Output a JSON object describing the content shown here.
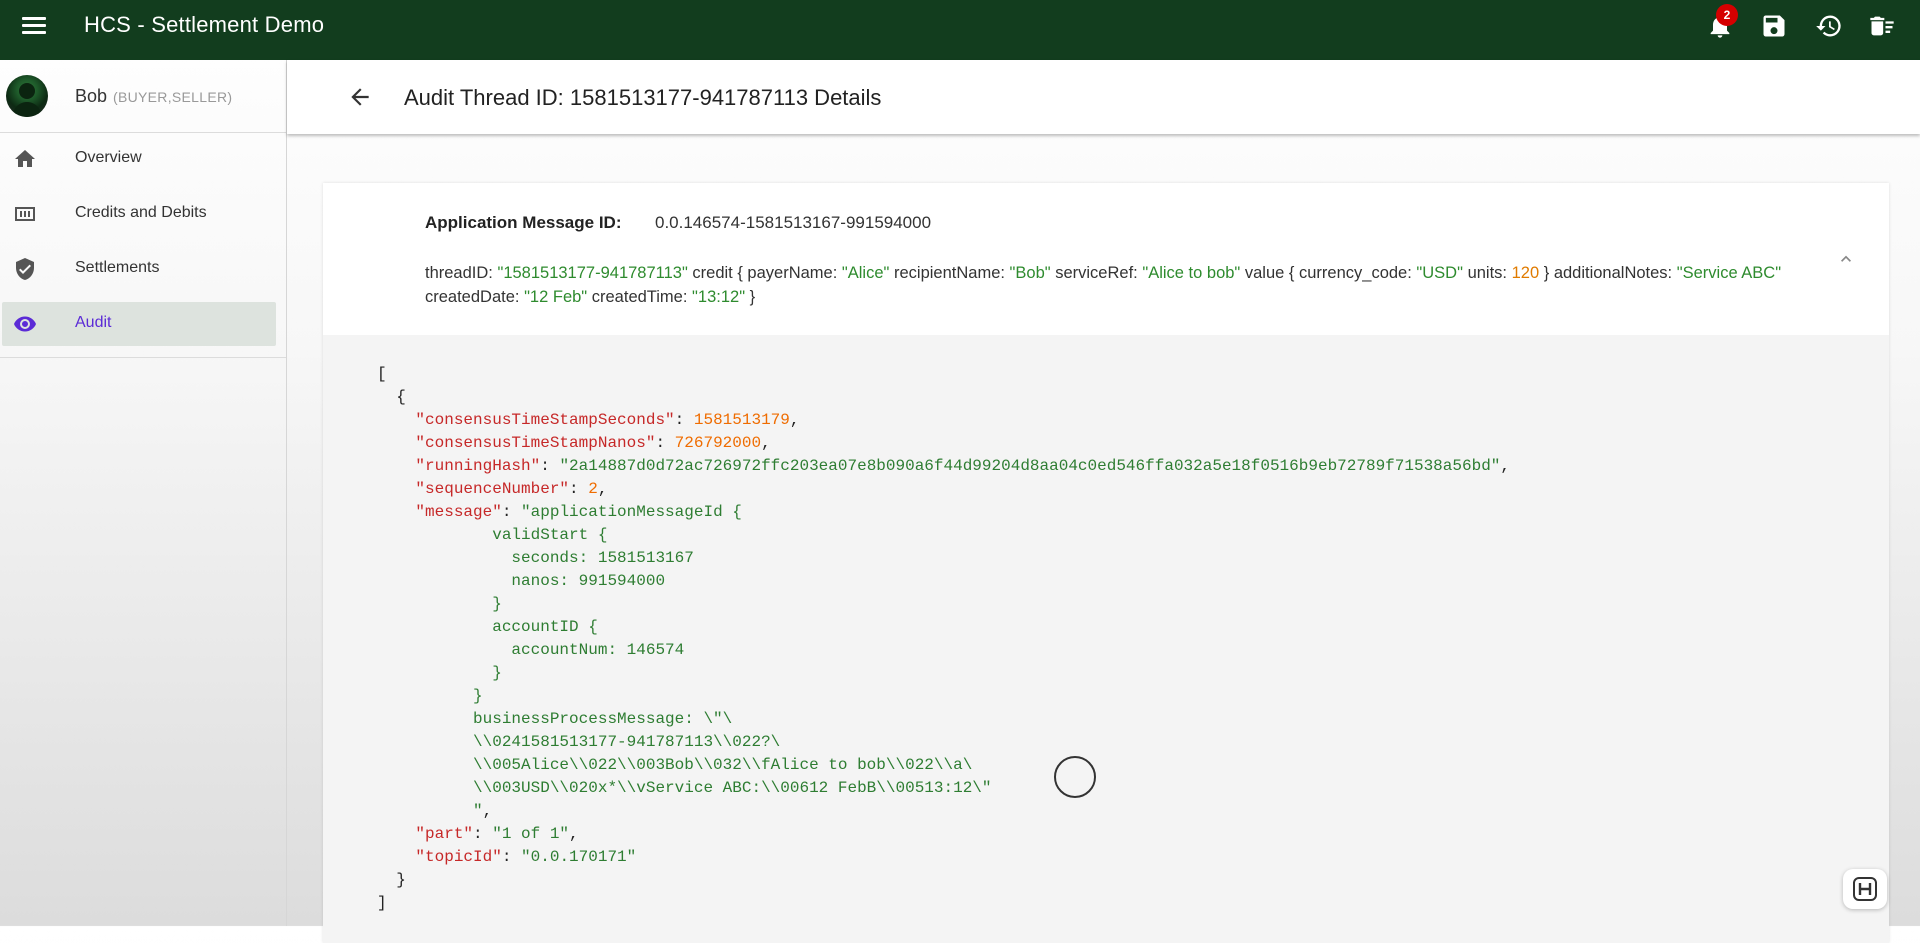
{
  "app": {
    "title": "HCS - Settlement Demo",
    "notification_count": "2"
  },
  "user": {
    "name": "Bob",
    "roles": "(BUYER,SELLER)"
  },
  "nav": {
    "items": [
      {
        "label": "Overview",
        "icon": "home-icon"
      },
      {
        "label": "Credits and Debits",
        "icon": "money-icon"
      },
      {
        "label": "Settlements",
        "icon": "verified-shield-icon"
      },
      {
        "label": "Audit",
        "icon": "eye-icon",
        "active": true
      }
    ]
  },
  "header": {
    "title": "Audit Thread ID: 1581513177-941787113 Details"
  },
  "card": {
    "msg_id_label": "Application Message ID:",
    "msg_id_value": "0.0.146574-1581513167-991594000",
    "summary": {
      "thread_key": "threadID:",
      "thread_val": "\"1581513177-941787113\"",
      "credit_open": "credit { payerName:",
      "payer": "\"Alice\"",
      "recipient_key": "recipientName:",
      "recipient": "\"Bob\"",
      "service_key": "serviceRef:",
      "service": "\"Alice to bob\"",
      "value_key": "value { currency_code:",
      "currency": "\"USD\"",
      "units_key": "units:",
      "units": "120",
      "notes_key": "} additionalNotes:",
      "notes": "\"Service ABC\"",
      "date_key": "createdDate:",
      "date": "\"12 Feb\"",
      "time_key": "createdTime:",
      "time": "\"13:12\"",
      "close": "}"
    },
    "json": {
      "open_bracket": "[",
      "open_brace": "{",
      "k_seconds": "\"consensusTimeStampSeconds\"",
      "v_seconds": "1581513179",
      "k_nanos": "\"consensusTimeStampNanos\"",
      "v_nanos": "726792000",
      "k_hash": "\"runningHash\"",
      "v_hash": "\"2a14887d0d72ac726972ffc203ea07e8b090a6f44d99204d8aa04c0ed546ffa032a5e18f0516b9eb72789f71538a56bd\"",
      "k_seq": "\"sequenceNumber\"",
      "v_seq": "2",
      "k_message": "\"message\"",
      "v_message": "\"applicationMessageId {\n            validStart {\n              seconds: 1581513167\n              nanos: 991594000\n            }\n            accountID {\n              accountNum: 146574\n            }\n          }\n          businessProcessMessage: \\\"\\\n          \\\\0241581513177-941787113\\\\022?\\\n          \\\\005Alice\\\\022\\\\003Bob\\\\032\\\\fAlice to bob\\\\022\\\\a\\\n          \\\\003USD\\\\020x*\\\\vService ABC:\\\\00612 FebB\\\\00513:12\\\"\n          \"",
      "k_part": "\"part\"",
      "v_part": "\"1 of 1\"",
      "k_topic": "\"topicId\"",
      "v_topic": "\"0.0.170171\"",
      "close_brace": "}",
      "close_bracket": "]"
    }
  }
}
